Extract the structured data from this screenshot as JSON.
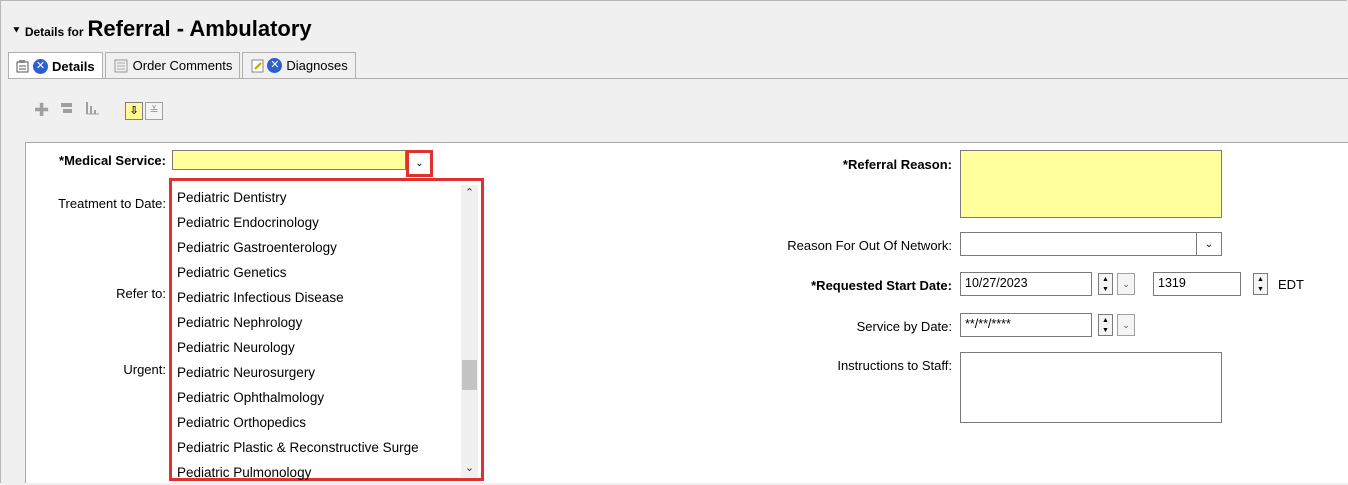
{
  "header": {
    "collapse_glyph": "⯆",
    "details_for": "Details for",
    "title": "Referral - Ambulatory"
  },
  "tabs": [
    {
      "label": "Details",
      "icon": "details-icon",
      "active": true
    },
    {
      "label": "Order Comments",
      "icon": "comments-icon",
      "active": false
    },
    {
      "label": "Diagnoses",
      "icon": "diagnoses-icon",
      "active": false
    }
  ],
  "form": {
    "medical_service_label": "*Medical Service:",
    "medical_service_value": "",
    "treatment_label": "Treatment to Date:",
    "refer_label": "Refer to:",
    "urgent_label": "Urgent:",
    "referral_reason_label": "*Referral Reason:",
    "out_of_network_label": "Reason For Out Of Network:",
    "start_date_label": "*Requested Start Date:",
    "start_date_value": "10/27/2023",
    "start_time_value": "1319",
    "timezone": "EDT",
    "service_by_label": "Service by Date:",
    "service_by_value": "**/**/****",
    "instructions_label": "Instructions to Staff:"
  },
  "dropdown": {
    "options": [
      "Pediatric Dentistry",
      "Pediatric Endocrinology",
      "Pediatric Gastroenterology",
      "Pediatric Genetics",
      "Pediatric Infectious Disease",
      "Pediatric Nephrology",
      "Pediatric Neurology",
      "Pediatric Neurosurgery",
      "Pediatric Ophthalmology",
      "Pediatric Orthopedics",
      "Pediatric Plastic & Reconstructive Surge",
      "Pediatric Pulmonology"
    ]
  },
  "colors": {
    "required_field": "#ffff9c",
    "highlight_border": "#e03131",
    "cancel_icon": "#2d5fcf"
  }
}
